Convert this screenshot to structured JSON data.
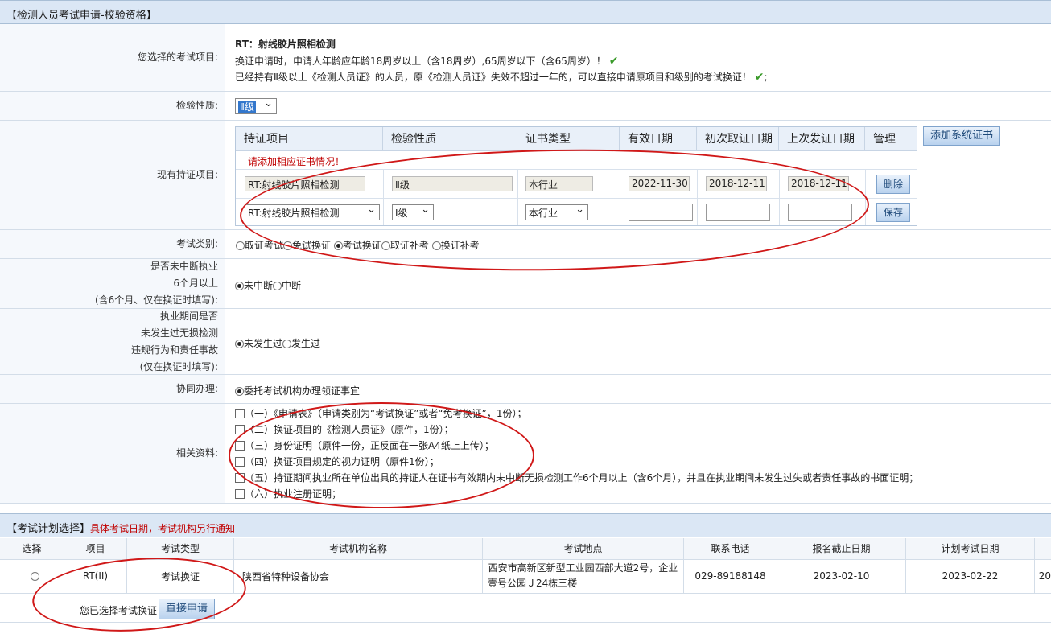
{
  "section1": {
    "title": "【检测人员考试申请-校验资格】"
  },
  "exam_item": {
    "label": "您选择的考试项目:",
    "name": "RT：射线胶片照相检测",
    "line1": "换证申请时，申请人年龄应年龄18周岁以上（含18周岁）,65周岁以下（含65周岁）！",
    "line2": "已经持有Ⅱ级以上《检测人员证》的人员，原《检测人员证》失效不超过一年的，可以直接申请原项目和级别的考试换证！",
    "line2_tail": ";"
  },
  "level": {
    "label": "检验性质:",
    "selected": "Ⅱ级"
  },
  "certs": {
    "label": "现有持证项目:",
    "headers": [
      "持证项目",
      "检验性质",
      "证书类型",
      "有效日期",
      "初次取证日期",
      "上次发证日期",
      "管理"
    ],
    "warning": "请添加相应证书情况！",
    "existing": {
      "item": "RT:射线胶片照相检测",
      "level": "Ⅱ级",
      "type": "本行业",
      "valid": "2022-11-30",
      "first": "2018-12-11",
      "last": "2018-12-11",
      "action": "删除"
    },
    "new_row": {
      "item": "RT:射线胶片照相检测",
      "level": "Ⅰ级",
      "type": "本行业",
      "action": "保存"
    },
    "add_button": "添加系统证书"
  },
  "exam_type": {
    "label": "考试类别:",
    "options": [
      "取证考试",
      "免试换证",
      "考试换证",
      "取证补考",
      "换证补考"
    ],
    "selected_index": 2
  },
  "continuous": {
    "label_lines": [
      "是否未中断执业",
      "6个月以上",
      "(含6个月、仅在换证时填写):"
    ],
    "options": [
      "未中断",
      "中断"
    ]
  },
  "accident": {
    "label_lines": [
      "执业期间是否",
      "未发生过无损检测",
      "违规行为和责任事故",
      "(仅在换证时填写):"
    ],
    "options": [
      "未发生过",
      "发生过"
    ]
  },
  "assist": {
    "label": "协同办理:",
    "option": "委托考试机构办理领证事宜"
  },
  "materials": {
    "label": "相关资料:",
    "items": [
      "（一）《申请表》（申请类别为“考试换证”或者“免考换证”，1份）；",
      "（二）换证项目的《检测人员证》（原件，1份）；",
      "（三）身份证明（原件一份，正反面在一张A4纸上上传）；",
      "（四）换证项目规定的视力证明（原件1份）；",
      "（五）持证期间执业所在单位出具的持证人在证书有效期内未中断无损检测工作6个月以上（含6个月），并且在执业期间未发生过失或者责任事故的书面证明；",
      "（六）执业注册证明；"
    ]
  },
  "section2": {
    "title": "【考试计划选择】",
    "note": "具体考试日期，考试机构另行通知"
  },
  "plan": {
    "headers": [
      "选择",
      "项目",
      "考试类型",
      "考试机构名称",
      "考试地点",
      "联系电话",
      "报名截止日期",
      "计划考试日期"
    ],
    "row": {
      "project": "RT(II)",
      "type": "考试换证",
      "org": "陕西省特种设备协会",
      "place_line1": "西安市高新区新型工业园西部大道2号，企业",
      "place_line2": "壹号公园Ｊ24栋三楼",
      "phone": "029-89188148",
      "deadline": "2023-02-10",
      "exam_date": "2023-02-22",
      "overflow": "20"
    },
    "chosen_text": "您已选择考试换证",
    "apply_button": "直接申请"
  },
  "colors": {
    "header_bg": "#dbe7f5",
    "annotation": "#d01818",
    "warning": "#c00000"
  }
}
